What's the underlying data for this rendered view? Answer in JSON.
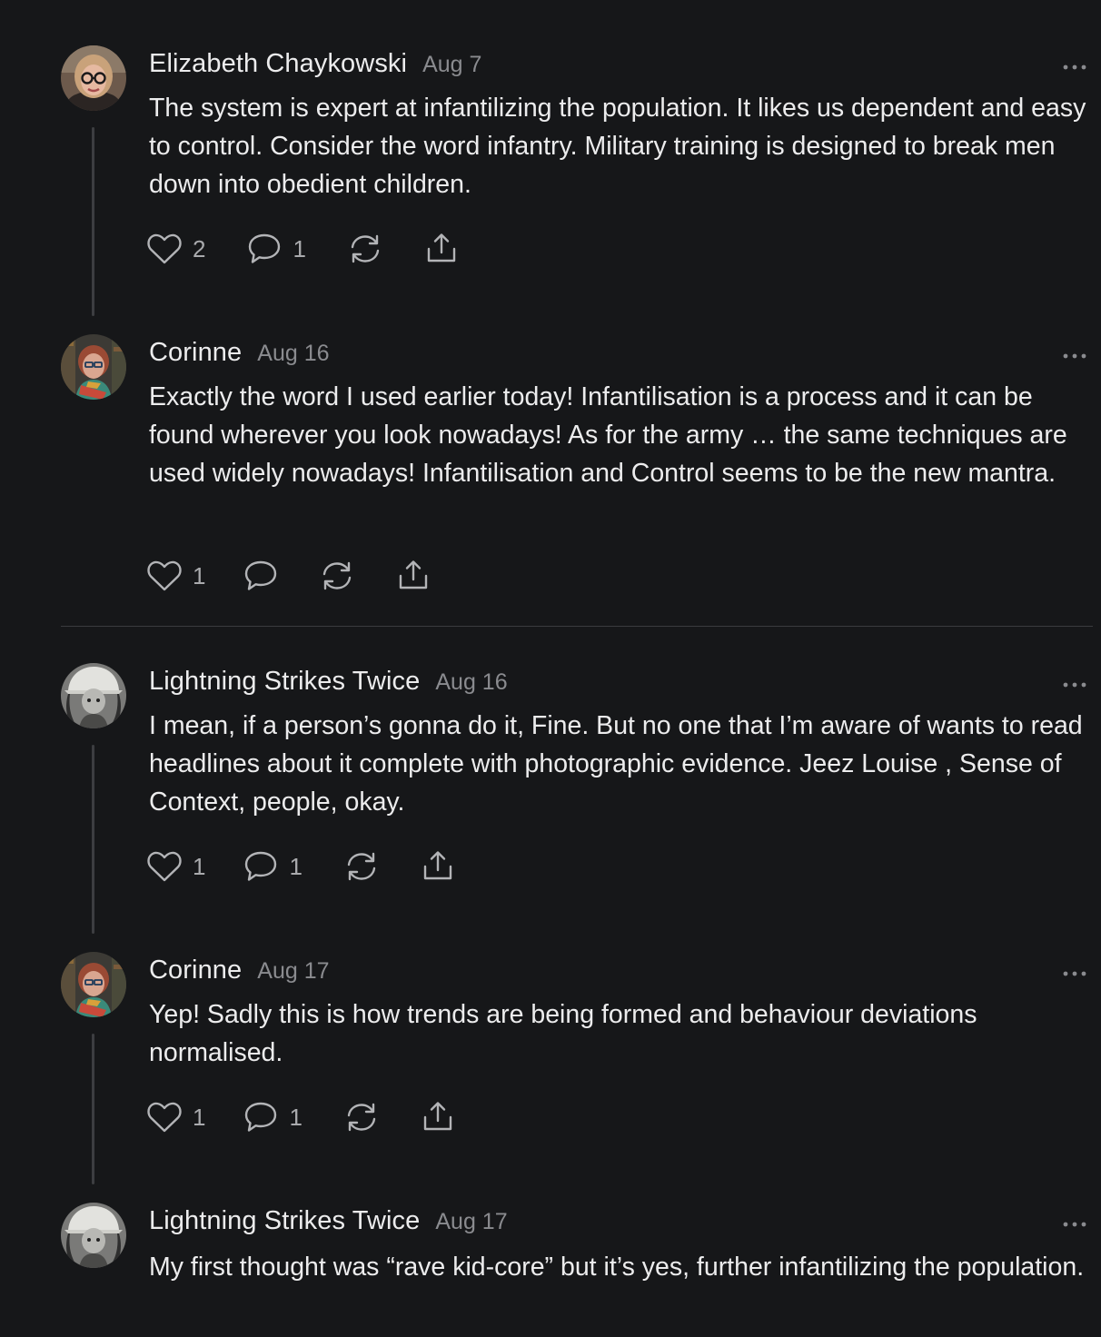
{
  "comments": [
    {
      "author": "Elizabeth Chaykowski",
      "date": "Aug 7",
      "text": "The system is expert at infantilizing the population. It likes us dependent and easy to control. Consider the word infantry. Military training is designed to break men down into obedient children.",
      "likes": "2",
      "replies": "1"
    },
    {
      "author": "Corinne",
      "date": "Aug 16",
      "text": "Exactly the word I used earlier today! Infantilisation is a process and it can be found wherever you look nowadays! As for the army … the same techniques are used widely nowadays! Infantilisation and Control seems to be the new mantra.",
      "likes": "1",
      "replies": ""
    },
    {
      "author": "Lightning Strikes Twice",
      "date": "Aug 16",
      "text": "I mean, if a person’s gonna do it, Fine. But no one that I’m aware of wants to read headlines about it complete with photographic evidence. Jeez Louise , Sense of Context, people, okay.",
      "likes": "1",
      "replies": "1"
    },
    {
      "author": "Corinne",
      "date": "Aug 17",
      "text": "Yep! Sadly this is how trends are being formed and behaviour deviations normalised.",
      "likes": "1",
      "replies": "1"
    },
    {
      "author": "Lightning Strikes Twice",
      "date": "Aug 17",
      "text": "My first thought was “rave kid-core” but it’s yes, further infantilizing the population."
    }
  ],
  "icons": {
    "like": "heart-icon",
    "reply": "speech-bubble-icon",
    "restack": "restack-icon",
    "share": "share-icon",
    "more": "ellipsis-icon"
  },
  "colors": {
    "background": "#161719",
    "text": "#ececed",
    "muted": "#8a8b8f",
    "thread_line": "#3d3e41"
  }
}
